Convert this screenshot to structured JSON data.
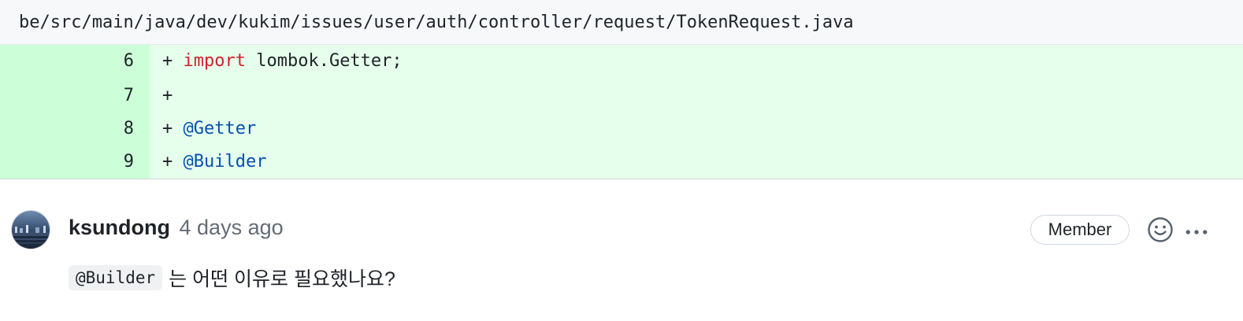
{
  "file": {
    "path": "be/src/main/java/dev/kukim/issues/user/auth/controller/request/TokenRequest.java"
  },
  "diff": {
    "lines": [
      {
        "num": "6",
        "prefix": "+ ",
        "keyword": "import",
        "rest": " lombok.Getter;"
      },
      {
        "num": "7",
        "prefix": "+"
      },
      {
        "num": "8",
        "prefix": "+ ",
        "annotation": "@Getter"
      },
      {
        "num": "9",
        "prefix": "+ ",
        "annotation": "@Builder"
      }
    ]
  },
  "comment": {
    "author": "ksundong",
    "time": "4 days ago",
    "badge": "Member",
    "code": "@Builder",
    "text": "는 어떤 이유로 필요했나요?",
    "icons": {
      "avatar": "avatar-photo",
      "reaction": "smiley-icon",
      "more": "kebab-horizontal-icon"
    }
  }
}
